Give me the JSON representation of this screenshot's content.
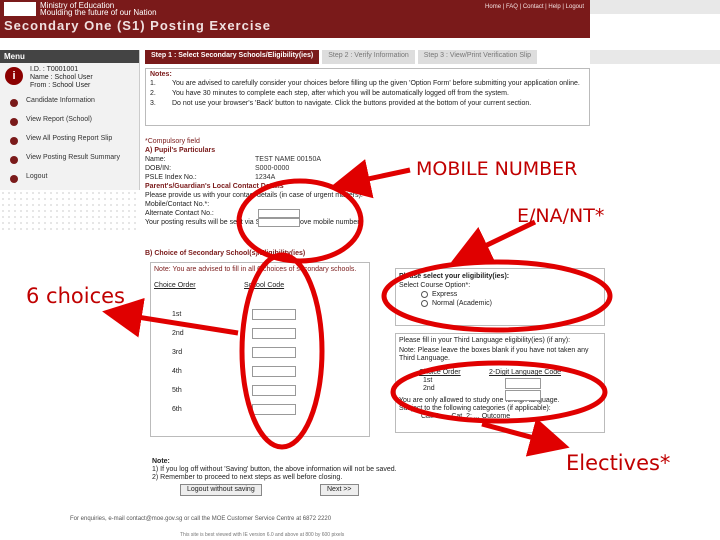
{
  "header": {
    "org": "Ministry of Education",
    "org_tagline": "Moulding the future of our Nation",
    "title": "Secondary One (S1) Posting Exercise",
    "links": "Home | FAQ | Contact | Help | Logout"
  },
  "sidebar": {
    "menu_title": "Menu",
    "profile": {
      "id_label": "I.D.",
      "id_value": ": T0001001",
      "name_label": "Name",
      "name_value": ": School User",
      "from_label": "From",
      "from_value": ": School User"
    },
    "items": [
      {
        "label": "Candidate Information"
      },
      {
        "label": "View Report (School)"
      },
      {
        "label": "View All Posting Report Slip"
      },
      {
        "label": "View Posting Result Summary"
      },
      {
        "label": "Logout"
      }
    ]
  },
  "tabs": [
    {
      "label": "Step 1 : Select Secondary Schools/Eligibility(ies)"
    },
    {
      "label": "Step 2 : Verify Information"
    },
    {
      "label": "Step 3 : View/Print Verification Slip"
    }
  ],
  "notes": {
    "heading": "Notes:",
    "items": [
      {
        "num": "1.",
        "text": "You are advised to carefully consider your choices before filling up the given 'Option Form' before submitting your application online."
      },
      {
        "num": "2.",
        "text": "You have 30 minutes to complete each step, after which you will be automatically logged off from the system."
      },
      {
        "num": "3.",
        "text": "Do not use your browser's 'Back' button to navigate. Click the buttons provided at the bottom of your current section."
      }
    ]
  },
  "compulsory": "*Compulsory field",
  "sectionA": {
    "heading": "A) Pupil's Particulars",
    "name_label": "Name:",
    "name_value": "TEST NAME 00150A",
    "dob_label": "DOB/IN:",
    "dob_value": "S000-0000",
    "psle_label": "PSLE Index No.:",
    "psle_value": "1234A",
    "parent_heading": "Parent's/Guardian's Local Contact Details",
    "parent_note": "Please provide us with your contact details (in case of urgent matters).",
    "mobile_label": "Mobile/Contact No.*:",
    "alt_label": "Alternate Contact No.:",
    "footer_note": "Your posting results will be sent via SMS to the above mobile number."
  },
  "sectionB": {
    "heading": "B) Choice of Secondary School(s)/Eligibility(ies)",
    "panel_note": "Note: You are advised to fill in all 6 choices of secondary schools.",
    "col_order": "Choice Order",
    "col_code": "School Code",
    "choices": [
      "1st",
      "2nd",
      "3rd",
      "4th",
      "5th",
      "6th"
    ]
  },
  "course": {
    "heading": "Please select your eligibility(ies):",
    "label": "Select Course Option*:",
    "options": [
      "Express",
      "Normal (Academic)"
    ]
  },
  "language": {
    "heading": "Please fill in your Third Language eligibility(ies) (if any):",
    "note": "Note: Please leave the boxes blank if you have not taken any Third Language.",
    "col1": "Choice Order",
    "col2": "2-Digit Language Code",
    "rows": [
      "1st",
      "2nd"
    ],
    "allowed": "You are only allowed to study one foreign language.",
    "sub": "Subject to the following categories (if applicable):",
    "last": "Cat. 1: ... Cat. 2: ... Outcome"
  },
  "notes2": {
    "heading": "Note:",
    "line1": "1) If you log off without 'Saving' button, the above information will not be saved.",
    "line2": "2) Remember to proceed to next steps as well before closing."
  },
  "buttons": {
    "logout": "Logout without saving",
    "next": "Next >>"
  },
  "footer": {
    "line1": "For enquiries, e-mail contact@moe.gov.sg or call the MOE Customer Service Centre at 6872 2220",
    "line2": "This site is best viewed with IE version 6.0 and above at 800 by 600 pixels"
  },
  "callouts": {
    "mobile": "MOBILE NUMBER",
    "course": "E/NA/NT*",
    "choices": "6 choices",
    "electives": "Electives*"
  },
  "colors": {
    "brand": "#7a1a1a",
    "annotation": "#e00000"
  }
}
